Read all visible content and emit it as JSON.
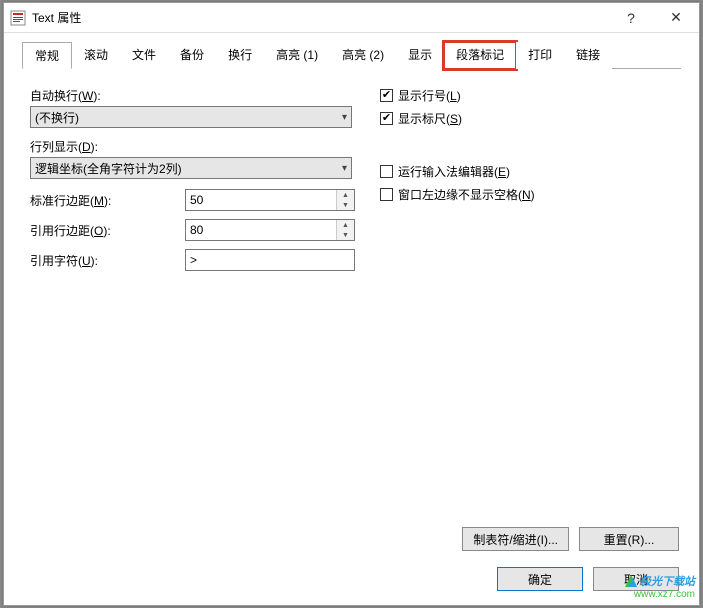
{
  "window": {
    "title": "Text 属性",
    "help_icon": "?",
    "close_icon": "✕"
  },
  "tabs": [
    {
      "label": "常规",
      "active": true
    },
    {
      "label": "滚动"
    },
    {
      "label": "文件"
    },
    {
      "label": "备份"
    },
    {
      "label": "换行"
    },
    {
      "label": "高亮 (1)"
    },
    {
      "label": "高亮 (2)"
    },
    {
      "label": "显示"
    },
    {
      "label": "段落标记",
      "highlight": true
    },
    {
      "label": "打印"
    },
    {
      "label": "链接"
    }
  ],
  "left": {
    "auto_wrap_label": "自动换行(W):",
    "auto_wrap_shortcut": "W",
    "auto_wrap_value": "(不换行)",
    "line_col_label": "行列显示(D):",
    "line_col_shortcut": "D",
    "line_col_value": "逻辑坐标(全角字符计为2列)",
    "std_margin_label": "标准行边距(M):",
    "std_margin_shortcut": "M",
    "std_margin_value": "50",
    "quote_margin_label": "引用行边距(O):",
    "quote_margin_shortcut": "O",
    "quote_margin_value": "80",
    "quote_char_label": "引用字符(U):",
    "quote_char_shortcut": "U",
    "quote_char_value": ">"
  },
  "right": {
    "show_line_no": {
      "label": "显示行号(L)",
      "shortcut": "L",
      "checked": true
    },
    "show_ruler": {
      "label": "显示标尺(S)",
      "shortcut": "S",
      "checked": true
    },
    "run_ime": {
      "label": "运行输入法编辑器(E)",
      "shortcut": "E",
      "checked": false
    },
    "no_left_space": {
      "label": "窗口左边缘不显示空格(N)",
      "shortcut": "N",
      "checked": false
    }
  },
  "buttons": {
    "tabs_indent": "制表符/缩进(I)...",
    "reset": "重置(R)...",
    "ok": "确定",
    "cancel": "取消"
  },
  "watermark": {
    "line1": "极光下载站",
    "line2": "www.xz7.com"
  }
}
